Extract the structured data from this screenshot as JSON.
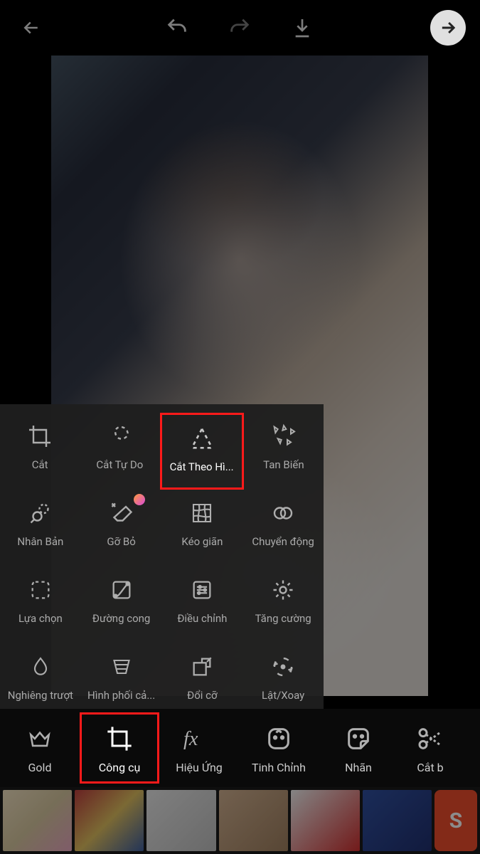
{
  "toolbar": {
    "back": "back",
    "undo": "undo",
    "redo": "redo",
    "download": "download",
    "next": "next"
  },
  "tools": {
    "rows": [
      [
        {
          "id": "crop",
          "label": "Cắt",
          "icon": "crop"
        },
        {
          "id": "freecrop",
          "label": "Cắt Tự Do",
          "icon": "lasso"
        },
        {
          "id": "shapecrop",
          "label": "Cắt Theo Hì...",
          "icon": "triangle-dashed",
          "highlight": true
        },
        {
          "id": "disperse",
          "label": "Tan Biến",
          "icon": "triangles-scatter"
        }
      ],
      [
        {
          "id": "clone",
          "label": "Nhân Bản",
          "icon": "clone"
        },
        {
          "id": "remove",
          "label": "Gỡ Bỏ",
          "icon": "eraser",
          "badge": true
        },
        {
          "id": "stretch",
          "label": "Kéo giãn",
          "icon": "grid-warp"
        },
        {
          "id": "motion",
          "label": "Chuyển động",
          "icon": "rings"
        }
      ],
      [
        {
          "id": "select",
          "label": "Lựa chọn",
          "icon": "select-dashed"
        },
        {
          "id": "curves",
          "label": "Đường cong",
          "icon": "curve"
        },
        {
          "id": "adjust",
          "label": "Điều chỉnh",
          "icon": "sliders"
        },
        {
          "id": "enhance",
          "label": "Tăng cường",
          "icon": "sun"
        }
      ],
      [
        {
          "id": "tiltshift",
          "label": "Nghiêng trượt",
          "icon": "drop"
        },
        {
          "id": "perspective",
          "label": "Hình phối cả...",
          "icon": "perspective"
        },
        {
          "id": "resize",
          "label": "Đổi cỡ",
          "icon": "resize"
        },
        {
          "id": "fliprotate",
          "label": "Lật/Xoay",
          "icon": "rotate"
        }
      ]
    ]
  },
  "bottom": {
    "items": [
      {
        "id": "gold",
        "label": "Gold",
        "icon": "crown"
      },
      {
        "id": "tools",
        "label": "Công cụ",
        "icon": "crop",
        "active": true,
        "highlight": true
      },
      {
        "id": "fx",
        "label": "Hiệu Ứng",
        "icon": "fx"
      },
      {
        "id": "finetune",
        "label": "Tinh Chỉnh",
        "icon": "face"
      },
      {
        "id": "sticker",
        "label": "Nhãn",
        "icon": "sticker"
      },
      {
        "id": "cutb",
        "label": "Cắt b",
        "icon": "scissors"
      }
    ]
  },
  "ad": {
    "brand": "S"
  }
}
